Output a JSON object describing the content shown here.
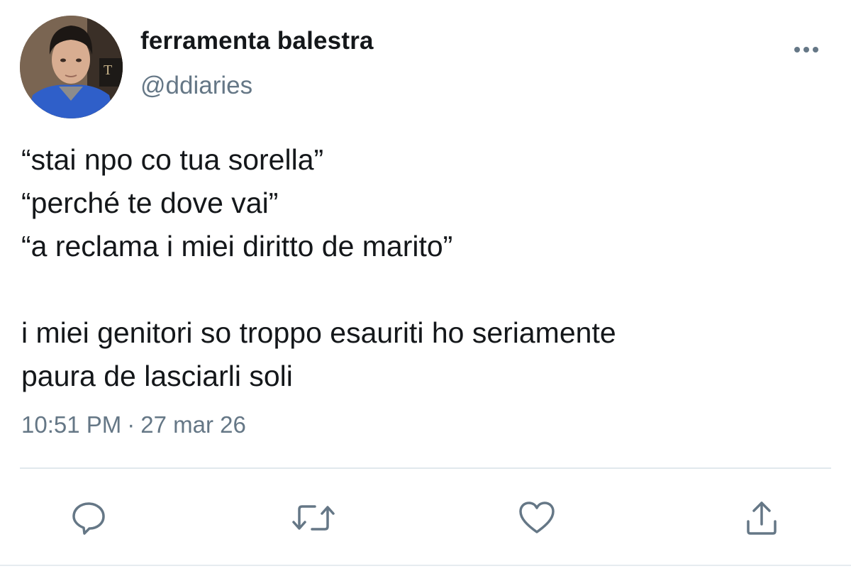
{
  "tweet": {
    "author": {
      "display_name": "ferramenta balestra",
      "handle": "@ddiaries"
    },
    "text": "“stai npo co tua sorella”\n“perché te dove vai”\n“a reclama i miei diritto de marito”\n\ni miei genitori so troppo esauriti ho seriamente\npaura de lasciarli soli",
    "time": "10:51 PM",
    "separator": "·",
    "date": "27 mar 26"
  },
  "icons": {
    "more": "more-horizontal-icon",
    "reply": "reply-bubble-icon",
    "retweet": "retweet-icon",
    "like": "heart-icon",
    "share": "share-upload-icon"
  },
  "colors": {
    "text_primary": "#14171a",
    "text_secondary": "#657786",
    "icon": "#657786",
    "divider": "#e1e8ed"
  }
}
